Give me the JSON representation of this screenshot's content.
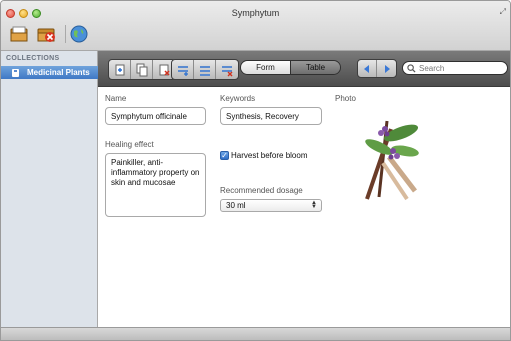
{
  "window": {
    "title": "Symphytum"
  },
  "toolbar": {
    "icons": [
      "new-collection-icon",
      "delete-collection-icon",
      "sync-globe-icon"
    ]
  },
  "sidebar": {
    "header": "COLLECTIONS",
    "items": [
      {
        "label": "Medicinal Plants",
        "selected": true
      }
    ]
  },
  "main_toolbar": {
    "record_buttons": [
      "new-record-icon",
      "duplicate-record-icon",
      "delete-record-icon"
    ],
    "field_buttons": [
      "new-field-icon",
      "duplicate-field-icon",
      "delete-field-icon"
    ],
    "view_modes": [
      "Form",
      "Table"
    ],
    "active_view": "Form",
    "search": {
      "placeholder": "Search",
      "value": ""
    }
  },
  "form": {
    "name": {
      "label": "Name",
      "value": "Symphytum officinale"
    },
    "keywords": {
      "label": "Keywords",
      "value": "Synthesis, Recovery"
    },
    "photo": {
      "label": "Photo"
    },
    "healing_effect": {
      "label": "Healing effect",
      "value": "Painkiller, anti-inflammatory property on skin and mucosae"
    },
    "harvest": {
      "label": "Harvest before bloom",
      "checked": true
    },
    "dosage": {
      "label": "Recommended dosage",
      "value": "30 ml"
    }
  },
  "colors": {
    "selection_blue": "#3f78c5",
    "sidebar_bg": "#dde3ea",
    "toolbar_dark": "#4d4d4d"
  }
}
